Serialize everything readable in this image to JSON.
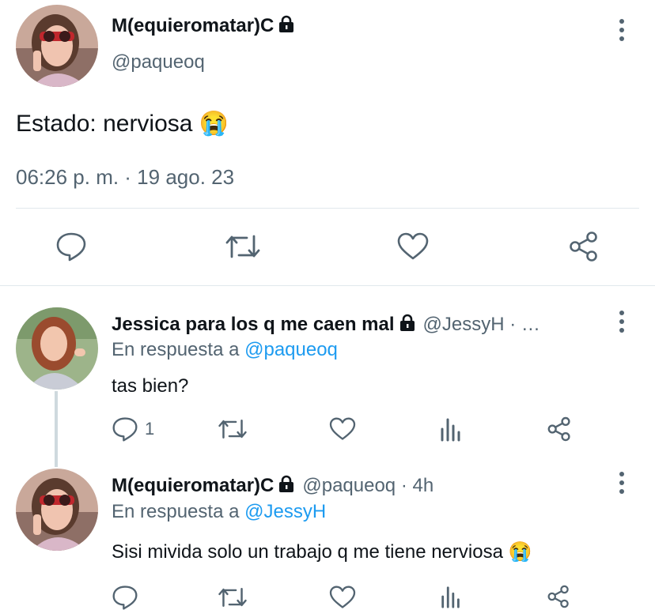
{
  "main_tweet": {
    "name": "M(equieromatar)C",
    "handle": "@paqueoq",
    "text": "Estado: nerviosa",
    "emoji": "😭",
    "timestamp": "06:26 p. m. · 19 ago. 23"
  },
  "replies": [
    {
      "name": "Jessica para los q me caen mal",
      "handle_time": "@JessyH · …",
      "reply_prefix": "En respuesta a",
      "reply_to": "@paqueoq",
      "text": "tas bien?",
      "reply_count": "1"
    },
    {
      "name": "M(equieromatar)C",
      "handle_time": "@paqueoq · 4h",
      "reply_prefix": "En respuesta a",
      "reply_to": "@JessyH",
      "text": "Sisi mivida solo un trabajo q me tiene nerviosa",
      "emoji": "😭",
      "reply_count": ""
    }
  ],
  "colors": {
    "text": "#0f1419",
    "secondary": "#536471",
    "link": "#1d9bf0",
    "divider": "#e1e8ed"
  },
  "icons": [
    "reply-icon",
    "retweet-icon",
    "like-icon",
    "share-icon",
    "views-icon",
    "lock-icon",
    "more-icon"
  ]
}
